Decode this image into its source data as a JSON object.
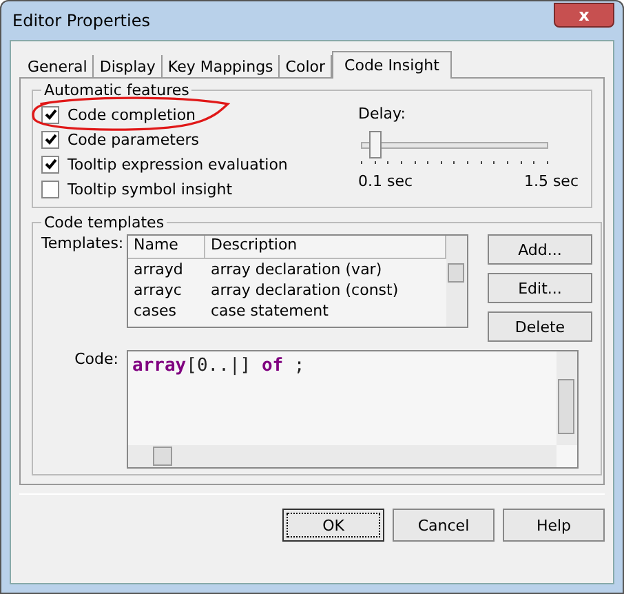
{
  "window": {
    "title": "Editor Properties",
    "close": "x"
  },
  "tabs": [
    {
      "label": "General",
      "selected": false
    },
    {
      "label": "Display",
      "selected": false
    },
    {
      "label": "Key Mappings",
      "selected": false
    },
    {
      "label": "Color",
      "selected": false
    },
    {
      "label": "Code Insight",
      "selected": true
    }
  ],
  "automatic_features": {
    "title": "Automatic features",
    "options": [
      {
        "label": "Code completion",
        "checked": true,
        "circled": true
      },
      {
        "label": "Code parameters",
        "checked": true,
        "circled": false
      },
      {
        "label": "Tooltip expression evaluation",
        "checked": true,
        "circled": false
      },
      {
        "label": "Tooltip symbol insight",
        "checked": false,
        "circled": false
      }
    ],
    "delay": {
      "label": "Delay:",
      "level": 0.05,
      "min_label": "0.1 sec",
      "max_label": "1.5 sec"
    }
  },
  "code_templates": {
    "title": "Code templates",
    "templates_label": "Templates:",
    "columns": [
      "Name",
      "Description"
    ],
    "rows": [
      {
        "name": "arrayd",
        "description": "array declaration (var)"
      },
      {
        "name": "arrayc",
        "description": "array declaration (const)"
      },
      {
        "name": "cases",
        "description": "case statement"
      }
    ],
    "buttons": [
      "Add...",
      "Edit...",
      "Delete"
    ],
    "code_label": "Code:",
    "code": "**array**[0..|] **of** ;"
  },
  "buttons": [
    {
      "label": "OK",
      "default": true
    },
    {
      "label": "Cancel",
      "default": false
    },
    {
      "label": "Help",
      "default": false
    }
  ]
}
